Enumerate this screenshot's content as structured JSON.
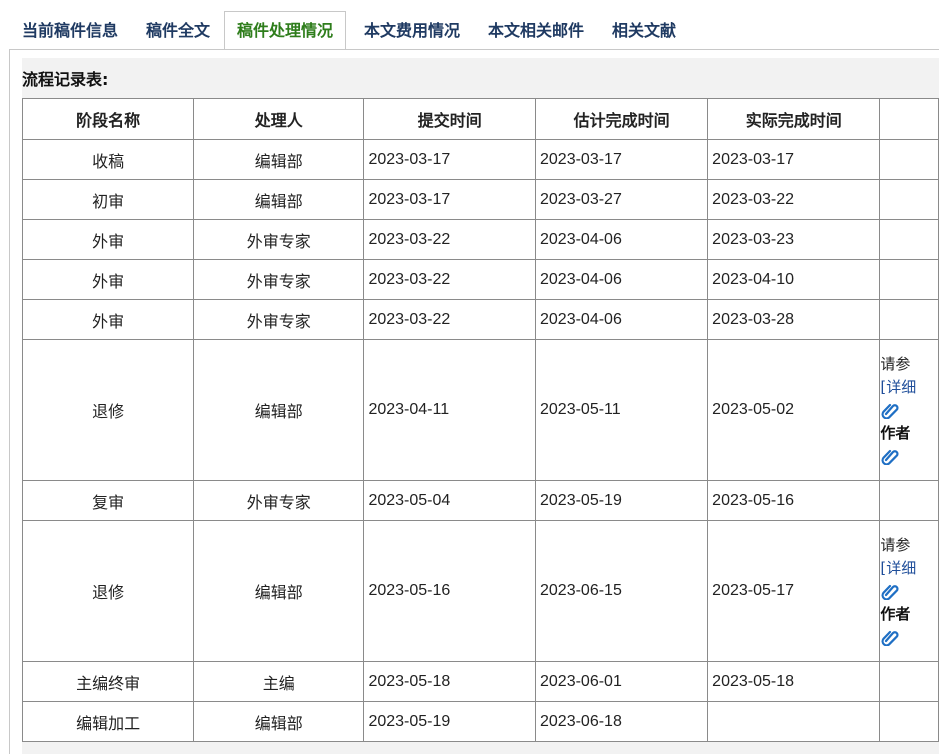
{
  "tabs": [
    {
      "label": "当前稿件信息",
      "active": false
    },
    {
      "label": "稿件全文",
      "active": false
    },
    {
      "label": "稿件处理情况",
      "active": true
    },
    {
      "label": "本文费用情况",
      "active": false
    },
    {
      "label": "本文相关邮件",
      "active": false
    },
    {
      "label": "相关文献",
      "active": false
    }
  ],
  "colors": {
    "tab_text": "#1f3a62",
    "tab_active_text": "#2e7d1b",
    "link": "#1f4e9a",
    "clip_icon": "#1f6fc4"
  },
  "panel_title": "流程记录表:",
  "table": {
    "headers": [
      "阶段名称",
      "处理人",
      "提交时间",
      "估计完成时间",
      "实际完成时间",
      ""
    ],
    "rows": [
      {
        "stage": "收稿",
        "handler": "编辑部",
        "submitted": "2023-03-17",
        "estimated": "2023-03-17",
        "actual": "2023-03-17"
      },
      {
        "stage": "初审",
        "handler": "编辑部",
        "submitted": "2023-03-17",
        "estimated": "2023-03-27",
        "actual": "2023-03-22"
      },
      {
        "stage": "外审",
        "handler": "外审专家",
        "submitted": "2023-03-22",
        "estimated": "2023-04-06",
        "actual": "2023-03-23"
      },
      {
        "stage": "外审",
        "handler": "外审专家",
        "submitted": "2023-03-22",
        "estimated": "2023-04-06",
        "actual": "2023-04-10"
      },
      {
        "stage": "外审",
        "handler": "外审专家",
        "submitted": "2023-03-22",
        "estimated": "2023-04-06",
        "actual": "2023-03-28"
      },
      {
        "stage": "退修",
        "handler": "编辑部",
        "submitted": "2023-04-11",
        "estimated": "2023-05-11",
        "actual": "2023-05-02",
        "note": {
          "line1": "请参",
          "link": "[详细",
          "line3": "作者",
          "clip_icon": "paperclip-icon"
        }
      },
      {
        "stage": "复审",
        "handler": "外审专家",
        "submitted": "2023-05-04",
        "estimated": "2023-05-19",
        "actual": "2023-05-16"
      },
      {
        "stage": "退修",
        "handler": "编辑部",
        "submitted": "2023-05-16",
        "estimated": "2023-06-15",
        "actual": "2023-05-17",
        "note": {
          "line1": "请参",
          "link": "[详细",
          "line3": "作者",
          "clip_icon": "paperclip-icon"
        }
      },
      {
        "stage": "主编终审",
        "handler": "主编",
        "submitted": "2023-05-18",
        "estimated": "2023-06-01",
        "actual": "2023-05-18"
      },
      {
        "stage": "编辑加工",
        "handler": "编辑部",
        "submitted": "2023-05-19",
        "estimated": "2023-06-18",
        "actual": ""
      }
    ]
  }
}
